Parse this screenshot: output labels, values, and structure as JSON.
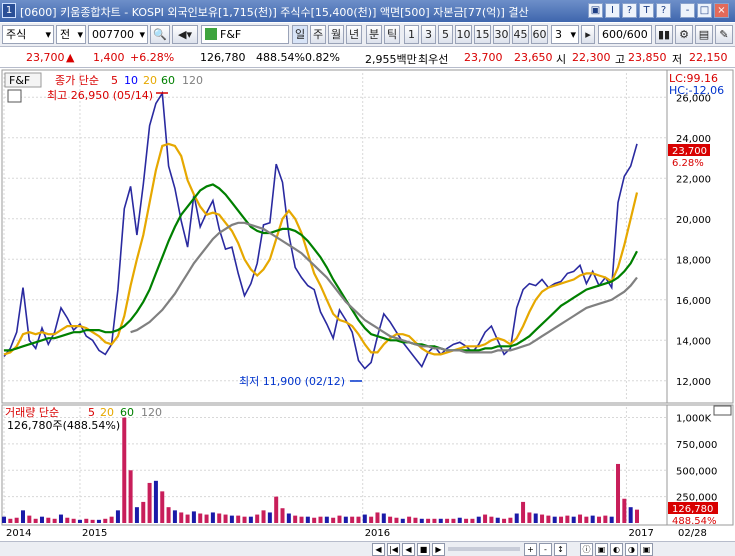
{
  "titlebar": {
    "number": "1",
    "title": "[0600] 키움종합차트 - KOSPI 외국인보유[1,715(천)] 주식수[15,400(천)] 액면[500] 자본금[77(억)] 결산",
    "buttons": [
      "▣",
      "I",
      "?",
      "T",
      "?",
      "-",
      "□",
      "×"
    ]
  },
  "toolbar": {
    "market": "주식",
    "market_options": "▾",
    "type": "전",
    "code": "007700",
    "name": "F&F",
    "period_label": "일",
    "periods": [
      "주",
      "월",
      "년",
      "분",
      "틱"
    ],
    "intervals": [
      "1",
      "3",
      "5",
      "10",
      "15",
      "30",
      "45",
      "60"
    ],
    "custom_interval": "3",
    "count": "600",
    "count_total": "/600"
  },
  "quote": {
    "price": "23,700",
    "direction_icon": "▲",
    "change": "1,400",
    "change_pct": "+6.28%",
    "volume": "126,780",
    "volume_pct": "488.54%",
    "turnover": "0.82%",
    "amount": "2,955백만",
    "best_bid_label": "최우선",
    "best_ask": "23,700",
    "best_bid": "23,650",
    "open_label": "시",
    "open": "22,300",
    "high_label": "고",
    "high": "23,850",
    "low_label": "저",
    "low": "22,150"
  },
  "chart_data": [
    {
      "type": "line",
      "title": "F&F",
      "legend": {
        "label": "종가 단순",
        "periods": [
          "5",
          "10",
          "20",
          "60",
          "120"
        ],
        "colors": [
          "#d80000",
          "#0000ff",
          "#e6a800",
          "#008000",
          "#808080"
        ]
      },
      "annotations": {
        "high": "최고 26,950 (05/14)",
        "low": "최저 11,900 (02/12)",
        "lc": "LC:99.16",
        "hc": "HC:-12.06",
        "last_price": "23,700",
        "last_pct": "6.28%"
      },
      "y_ticks": [
        "26,000",
        "24,000",
        "22,000",
        "20,000",
        "18,000",
        "16,000",
        "14,000",
        "12,000"
      ],
      "ylim": [
        11000,
        27200
      ],
      "x_ticks": [
        "2014",
        "2015",
        "2016",
        "2017",
        "02/28"
      ],
      "x": [
        0,
        6,
        12,
        18,
        24,
        30,
        36,
        42,
        48,
        54,
        60,
        66,
        72,
        78,
        84,
        90,
        96,
        102,
        108,
        114,
        120,
        126,
        132,
        138,
        144,
        150,
        156,
        162,
        168,
        174,
        180,
        186,
        192,
        198,
        204,
        210,
        216,
        222,
        228,
        234,
        240,
        246,
        252,
        258,
        264,
        270,
        276,
        282,
        288,
        294,
        300,
        306,
        312,
        318,
        324,
        330,
        336,
        342,
        348,
        354,
        360,
        366,
        372,
        378,
        384,
        390,
        396,
        402,
        408,
        414,
        420,
        426,
        432,
        438,
        444,
        450,
        456,
        462,
        468,
        474,
        480,
        486,
        492,
        498,
        504,
        510,
        516,
        522,
        528,
        534,
        540,
        546,
        552,
        558,
        564,
        570,
        576,
        582,
        588,
        594,
        600
      ],
      "series": [
        {
          "name": "종가",
          "color": "#2a2aa0",
          "values": [
            13200,
            13600,
            14400,
            16600,
            14000,
            13600,
            14600,
            13800,
            14400,
            15600,
            15100,
            14500,
            14800,
            14200,
            14000,
            13500,
            13300,
            13800,
            16500,
            20500,
            21600,
            19200,
            21700,
            24600,
            25700,
            26200,
            22600,
            21500,
            19900,
            18600,
            21200,
            19600,
            20300,
            20900,
            19500,
            18500,
            18600,
            17300,
            16200,
            16800,
            17800,
            19700,
            19800,
            22700,
            21800,
            19200,
            17600,
            17100,
            16700,
            16500,
            15400,
            14800,
            14100,
            15500,
            15000,
            14400,
            13000,
            12600,
            12900,
            14200,
            15300,
            14900,
            14400,
            13900,
            13500,
            13100,
            12700,
            13400,
            13700,
            13300,
            13600,
            13800,
            13900,
            13700,
            13400,
            13800,
            14400,
            14700,
            14000,
            13300,
            13600,
            15600,
            16500,
            16800,
            16700,
            17000,
            16600,
            16800,
            16900,
            17300,
            17400,
            17700,
            16800,
            17400,
            16700,
            17100,
            16600,
            20800,
            22100,
            22600,
            23700
          ]
        },
        {
          "name": "20",
          "color": "#e6a800",
          "values": [
            13300,
            13400,
            13700,
            14300,
            14400,
            14300,
            14400,
            14300,
            14300,
            14500,
            14700,
            14700,
            14700,
            14600,
            14400,
            14200,
            13900,
            13800,
            14200,
            15200,
            16700,
            18000,
            19200,
            20800,
            22400,
            23600,
            23700,
            23600,
            23100,
            21900,
            21200,
            20600,
            20200,
            20300,
            20200,
            19800,
            19400,
            18800,
            18000,
            17500,
            17200,
            17500,
            18000,
            19000,
            20000,
            20400,
            20000,
            19300,
            18300,
            17300,
            16700,
            16000,
            15300,
            15000,
            14900,
            14700,
            14300,
            13800,
            13400,
            13400,
            13800,
            14100,
            14300,
            14300,
            14200,
            13900,
            13600,
            13400,
            13300,
            13300,
            13400,
            13500,
            13600,
            13700,
            13700,
            13700,
            13800,
            14000,
            14100,
            14000,
            13800,
            14100,
            14700,
            15400,
            16000,
            16400,
            16600,
            16700,
            16800,
            16900,
            17000,
            17200,
            17300,
            17300,
            17200,
            17100,
            16900,
            17600,
            18700,
            20000,
            21300
          ]
        },
        {
          "name": "60",
          "color": "#008000",
          "values": [
            13500,
            13500,
            13600,
            13700,
            13800,
            13900,
            14000,
            14100,
            14100,
            14200,
            14300,
            14400,
            14400,
            14500,
            14500,
            14500,
            14400,
            14400,
            14500,
            14700,
            15000,
            15400,
            15900,
            16500,
            17300,
            18100,
            18900,
            19600,
            20200,
            20600,
            21000,
            21400,
            21600,
            21700,
            21500,
            21200,
            20800,
            20400,
            20000,
            19600,
            19400,
            19300,
            19300,
            19400,
            19500,
            19500,
            19400,
            19200,
            18900,
            18500,
            18100,
            17600,
            17000,
            16500,
            16000,
            15500,
            15000,
            14600,
            14300,
            14200,
            14100,
            14000,
            14000,
            13900,
            13900,
            13800,
            13800,
            13700,
            13700,
            13600,
            13500,
            13500,
            13500,
            13500,
            13500,
            13500,
            13600,
            13600,
            13700,
            13700,
            13700,
            13800,
            14000,
            14200,
            14500,
            14800,
            15100,
            15400,
            15700,
            15900,
            16100,
            16300,
            16500,
            16600,
            16700,
            16800,
            16900,
            17100,
            17400,
            17800,
            18400
          ]
        },
        {
          "name": "120",
          "color": "#808080",
          "values": [
            null,
            null,
            null,
            null,
            null,
            null,
            null,
            null,
            null,
            null,
            null,
            null,
            null,
            null,
            null,
            null,
            null,
            null,
            null,
            null,
            14400,
            14500,
            14700,
            14900,
            15200,
            15500,
            15900,
            16300,
            16800,
            17300,
            17800,
            18200,
            18600,
            19000,
            19300,
            19500,
            19700,
            19800,
            19800,
            19700,
            19600,
            19500,
            19300,
            19100,
            18900,
            18700,
            18500,
            18300,
            18000,
            17700,
            17400,
            17100,
            16700,
            16300,
            15900,
            15600,
            15300,
            15000,
            14800,
            14600,
            14400,
            14200,
            14100,
            14000,
            13900,
            13800,
            13700,
            13700,
            13600,
            13600,
            13500,
            13500,
            13500,
            13400,
            13400,
            13400,
            13400,
            13400,
            13500,
            13500,
            13500,
            13600,
            13700,
            13800,
            14000,
            14200,
            14400,
            14600,
            14800,
            15000,
            15200,
            15400,
            15600,
            15700,
            15800,
            15900,
            16000,
            16200,
            16400,
            16700,
            17100
          ]
        }
      ]
    },
    {
      "type": "bar",
      "title": "거래량",
      "legend": {
        "label": "거래량 단순",
        "periods": [
          "5",
          "20",
          "60",
          "120"
        ],
        "colors": [
          "#d80000",
          "#e6a800",
          "#008000",
          "#808080"
        ]
      },
      "info": "126,780주(488.54%)",
      "last_value": "126,780",
      "last_pct": "488.54%",
      "y_ticks": [
        "1,000K",
        "750,000",
        "500,000",
        "250,000"
      ],
      "ylim": [
        0,
        1100000
      ],
      "x": [
        0,
        6,
        12,
        18,
        24,
        30,
        36,
        42,
        48,
        54,
        60,
        66,
        72,
        78,
        84,
        90,
        96,
        102,
        108,
        114,
        120,
        126,
        132,
        138,
        144,
        150,
        156,
        162,
        168,
        174,
        180,
        186,
        192,
        198,
        204,
        210,
        216,
        222,
        228,
        234,
        240,
        246,
        252,
        258,
        264,
        270,
        276,
        282,
        288,
        294,
        300,
        306,
        312,
        318,
        324,
        330,
        336,
        342,
        348,
        354,
        360,
        366,
        372,
        378,
        384,
        390,
        396,
        402,
        408,
        414,
        420,
        426,
        432,
        438,
        444,
        450,
        456,
        462,
        468,
        474,
        480,
        486,
        492,
        498,
        504,
        510,
        516,
        522,
        528,
        534,
        540,
        546,
        552,
        558,
        564,
        570,
        576,
        582,
        588,
        594,
        600
      ],
      "values": [
        60000,
        40000,
        50000,
        120000,
        70000,
        40000,
        60000,
        50000,
        40000,
        80000,
        50000,
        40000,
        30000,
        40000,
        30000,
        30000,
        40000,
        60000,
        120000,
        1000000,
        500000,
        150000,
        200000,
        380000,
        400000,
        300000,
        150000,
        120000,
        100000,
        80000,
        110000,
        90000,
        80000,
        100000,
        90000,
        80000,
        70000,
        70000,
        60000,
        60000,
        80000,
        120000,
        100000,
        250000,
        140000,
        90000,
        70000,
        60000,
        60000,
        50000,
        60000,
        60000,
        50000,
        70000,
        60000,
        60000,
        60000,
        80000,
        60000,
        100000,
        90000,
        60000,
        50000,
        40000,
        60000,
        50000,
        40000,
        40000,
        40000,
        40000,
        40000,
        40000,
        50000,
        40000,
        40000,
        60000,
        80000,
        60000,
        50000,
        40000,
        50000,
        90000,
        200000,
        100000,
        90000,
        80000,
        70000,
        60000,
        60000,
        70000,
        60000,
        80000,
        60000,
        70000,
        60000,
        70000,
        60000,
        560000,
        230000,
        150000,
        126780
      ]
    }
  ],
  "status": {
    "buttons": [
      "◀",
      "|◀",
      "◀",
      "■",
      "▶",
      "+",
      "-",
      "↕"
    ],
    "right_buttons": [
      "ⓘ",
      "▣",
      "◐",
      "◑",
      "▣"
    ]
  }
}
